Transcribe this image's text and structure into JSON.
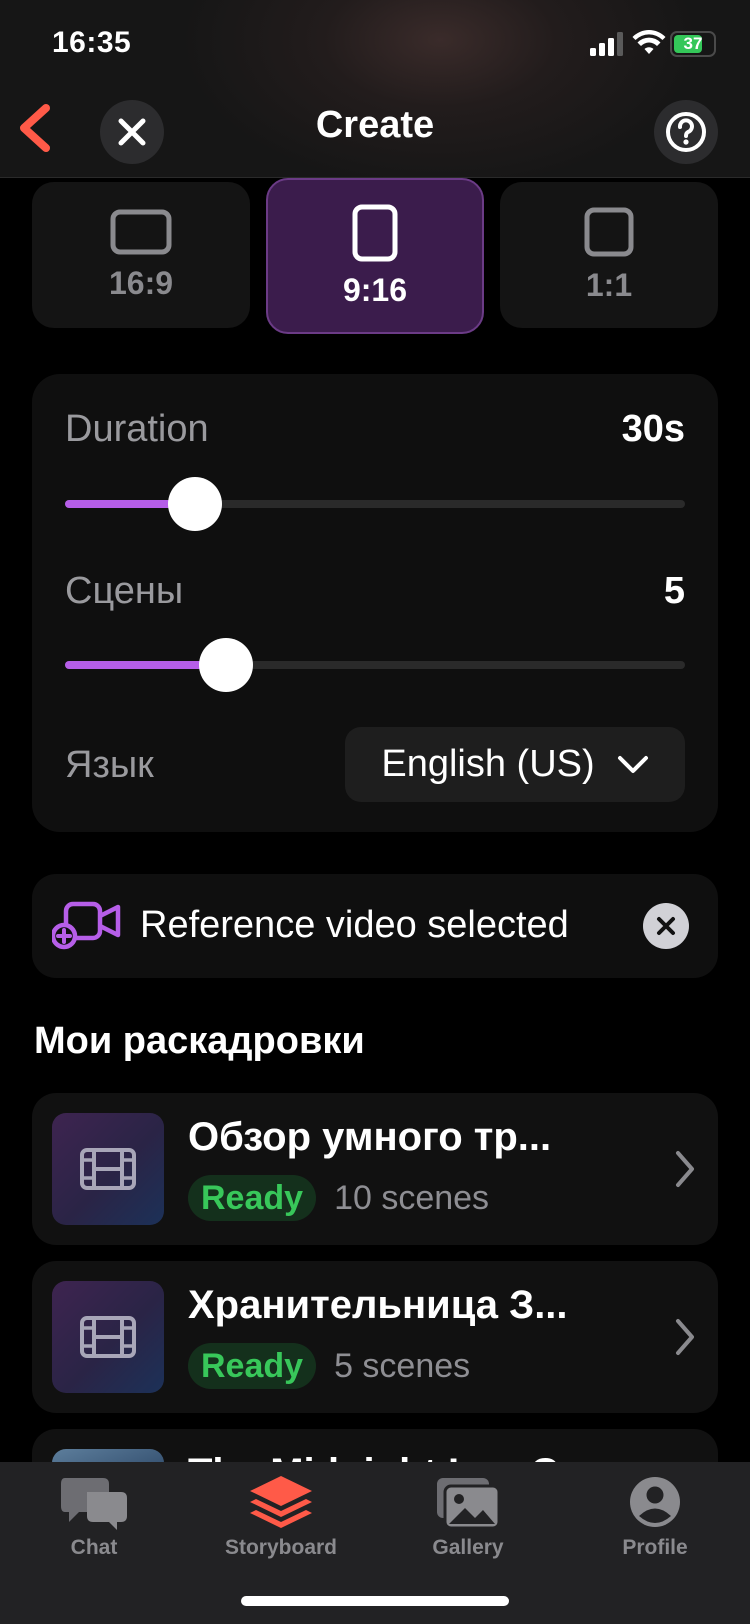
{
  "status_bar": {
    "time": "16:35",
    "battery": "37"
  },
  "header": {
    "title": "Create"
  },
  "aspect_ratios": [
    {
      "label": "16:9",
      "selected": false
    },
    {
      "label": "9:16",
      "selected": true
    },
    {
      "label": "1:1",
      "selected": false
    }
  ],
  "settings": {
    "duration": {
      "label": "Duration",
      "value": "30s",
      "level": 0.21
    },
    "scenes": {
      "label": "Сцены",
      "value": "5",
      "level": 0.26
    },
    "language": {
      "label": "Язык",
      "value": "English (US)"
    }
  },
  "reference": {
    "text": "Reference video selected"
  },
  "storyboards": {
    "title": "Мои раскадровки",
    "items": [
      {
        "title": "Обзор умного тр...",
        "status": "Ready",
        "scenes": "10 scenes"
      },
      {
        "title": "Хранительница З...",
        "status": "Ready",
        "scenes": "5 scenes"
      },
      {
        "title": "The Midnight Lag C..."
      }
    ]
  },
  "tabbar": {
    "tabs": [
      {
        "label": "Chat",
        "icon": "chat-bubbles-icon"
      },
      {
        "label": "Storyboard",
        "icon": "layers-icon",
        "active": true
      },
      {
        "label": "Gallery",
        "icon": "photos-icon"
      },
      {
        "label": "Profile",
        "icon": "person-icon"
      }
    ]
  },
  "colors": {
    "accent": "#ff5a48",
    "purple": "#b65ee8",
    "ready_green": "#38c75a"
  }
}
